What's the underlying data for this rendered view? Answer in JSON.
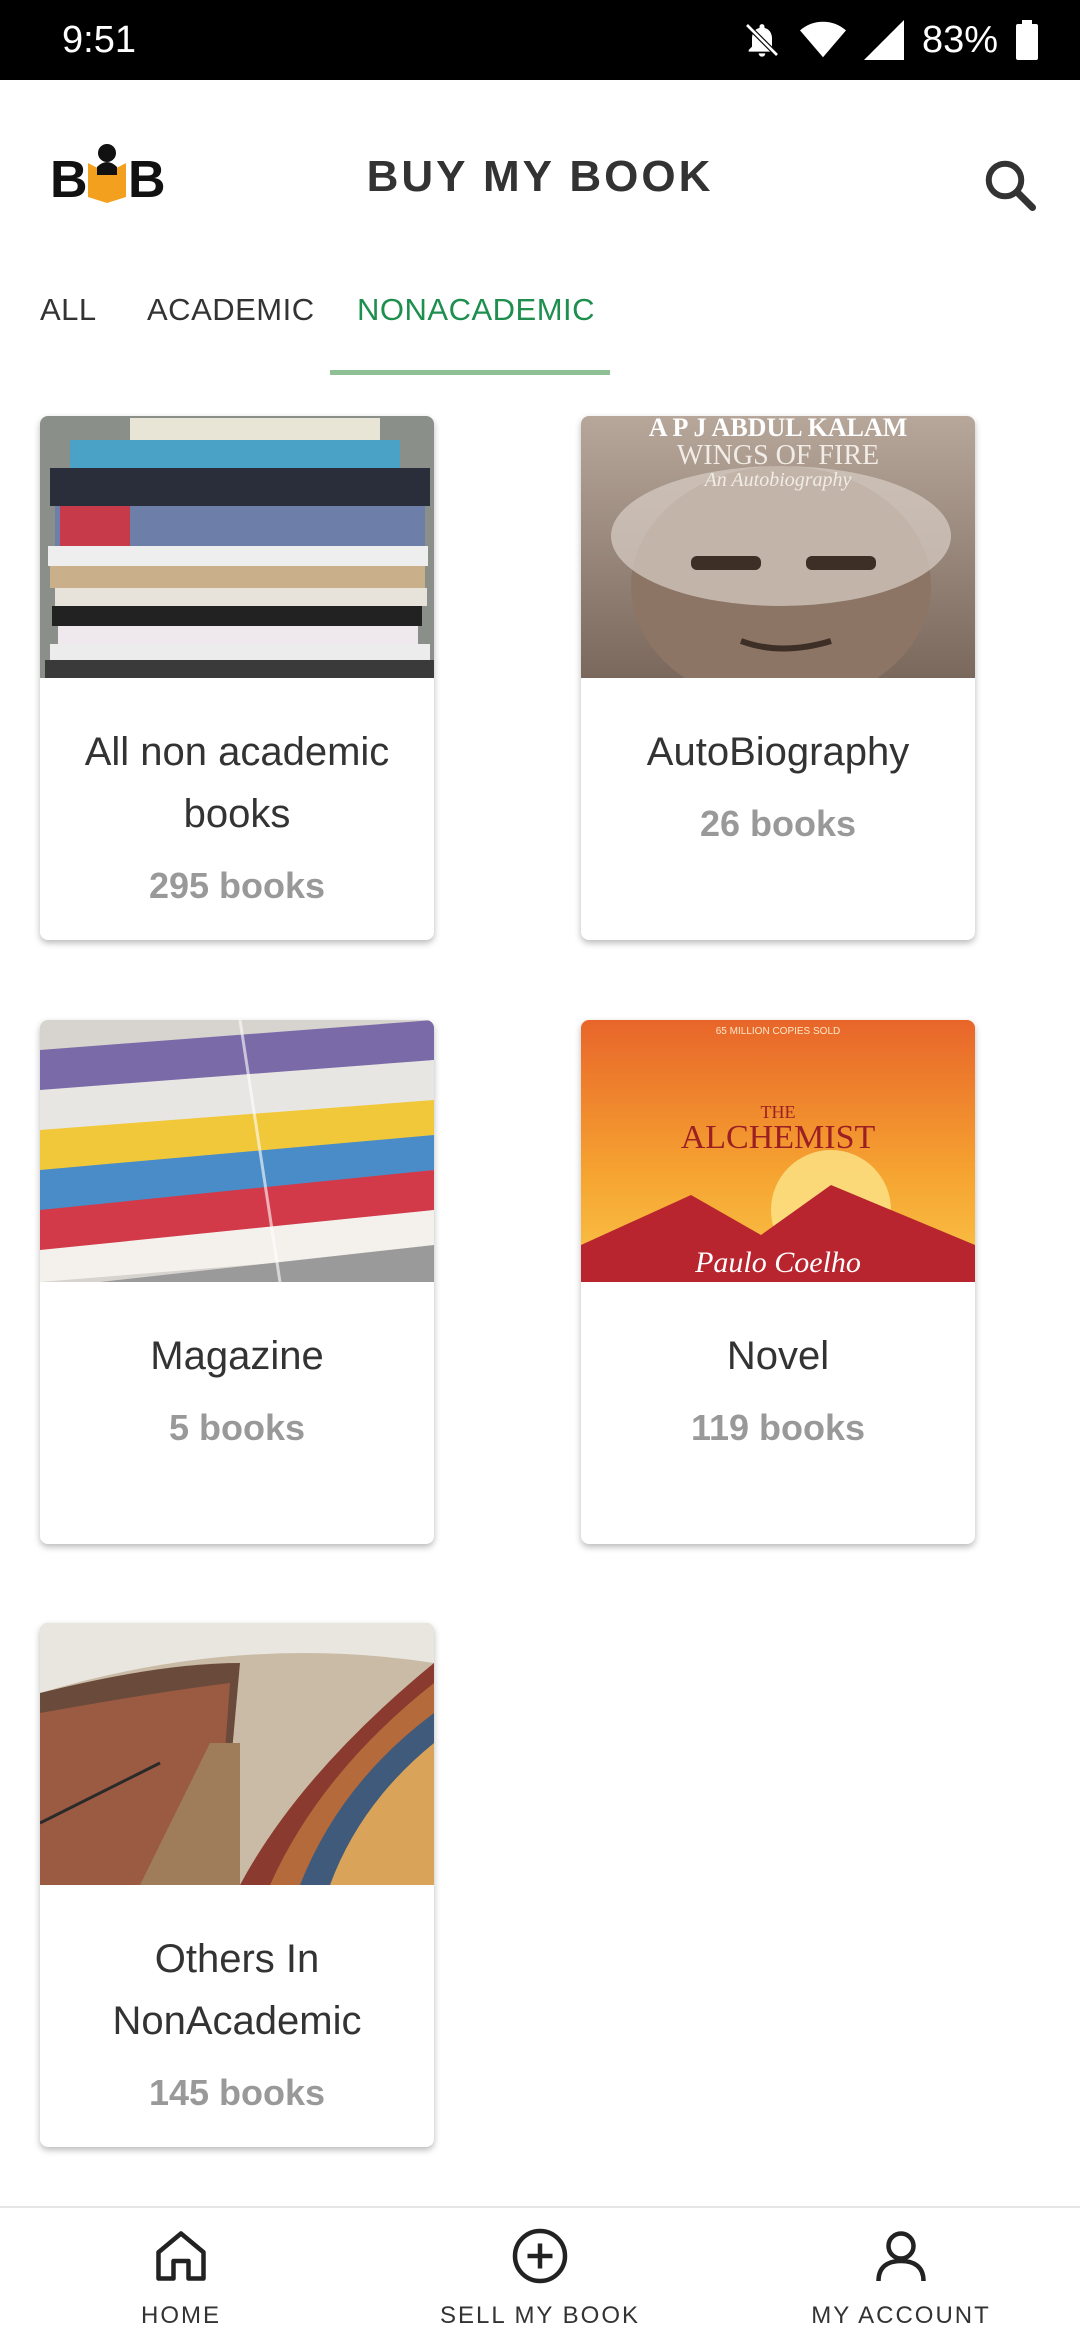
{
  "status_bar": {
    "time": "9:51",
    "battery": "83%"
  },
  "app_bar": {
    "logo_text": "BB",
    "title": "BUY MY BOOK",
    "search_icon": "search-icon"
  },
  "tabs": [
    {
      "label": "ALL",
      "active": false
    },
    {
      "label": "ACADEMIC",
      "active": false
    },
    {
      "label": "NONACADEMIC",
      "active": true
    }
  ],
  "categories": [
    {
      "name": "All non academic books",
      "count": "295 books",
      "cover_title": ""
    },
    {
      "name": "AutoBiography",
      "count": "26 books",
      "cover_title": "APJ ABDUL KALAM WINGS OF FIRE An Autobiography"
    },
    {
      "name": "Magazine",
      "count": "5 books",
      "cover_title": ""
    },
    {
      "name": "Novel",
      "count": "119 books",
      "cover_title": "THE ALCHEMIST Paulo Coelho"
    },
    {
      "name": "Others In NonAcademic",
      "count": "145 books",
      "cover_title": ""
    }
  ],
  "cover_text": {
    "autobiography_line1": "A P J ABDUL KALAM",
    "autobiography_line2": "WINGS OF FIRE",
    "autobiography_line3": "An Autobiography",
    "novel_top": "65 MILLION COPIES SOLD",
    "novel_title1": "THE",
    "novel_title2": "ALCHEMIST",
    "novel_author": "Paulo Coelho"
  },
  "bottom_nav": [
    {
      "label": "HOME",
      "icon": "home-icon"
    },
    {
      "label": "SELL MY BOOK",
      "icon": "plus-circle-icon"
    },
    {
      "label": "MY ACCOUNT",
      "icon": "person-icon"
    }
  ],
  "colors": {
    "accent": "#1e8f4e",
    "tab_underline": "#8fbf95",
    "muted_text": "#999999",
    "status_bar": "#000000"
  }
}
